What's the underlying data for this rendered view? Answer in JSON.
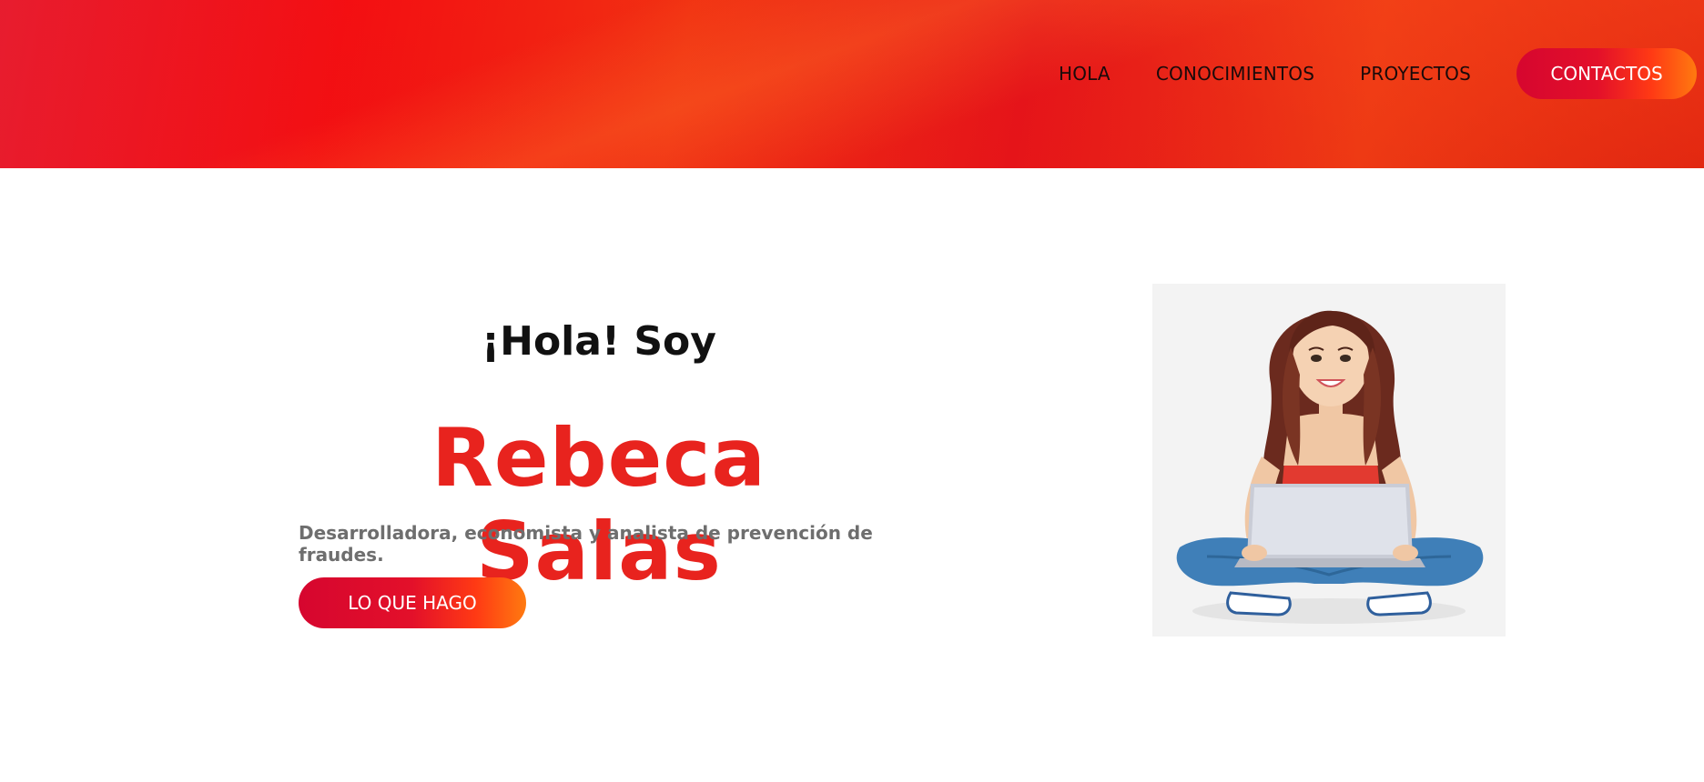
{
  "nav": {
    "links": [
      {
        "label": "HOLA"
      },
      {
        "label": "CONOCIMIENTOS"
      },
      {
        "label": "PROYECTOS"
      }
    ],
    "cta_label": "CONTACTOS"
  },
  "hero": {
    "greeting": "¡Hola! Soy",
    "name": "Rebeca Salas",
    "tagline": "Desarrolladora, economista y analista de prevención de fraudes.",
    "button_label": "LO QUE HAGO"
  },
  "colors": {
    "header_red": "#f80d12",
    "name_red": "#e8231e",
    "button_start": "#d6062f",
    "button_end": "#ff7a10"
  }
}
